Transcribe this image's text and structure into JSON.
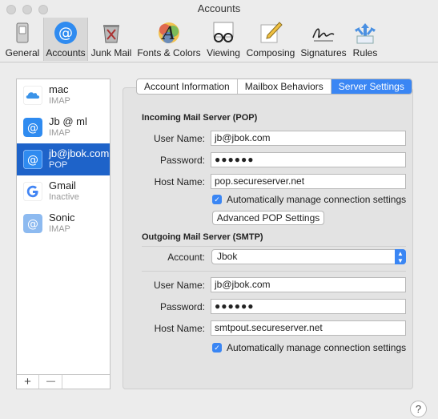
{
  "window": {
    "title": "Accounts"
  },
  "toolbar": {
    "items": [
      {
        "label": "General",
        "icon": "switch-icon"
      },
      {
        "label": "Accounts",
        "icon": "at-sign-icon"
      },
      {
        "label": "Junk Mail",
        "icon": "trash-bin-icon"
      },
      {
        "label": "Fonts & Colors",
        "icon": "font-a-icon"
      },
      {
        "label": "Viewing",
        "icon": "glasses-icon"
      },
      {
        "label": "Composing",
        "icon": "pencil-icon"
      },
      {
        "label": "Signatures",
        "icon": "signature-icon"
      },
      {
        "label": "Rules",
        "icon": "rules-arrows-icon"
      }
    ]
  },
  "accounts": [
    {
      "name": "mac",
      "type": "IMAP",
      "icon": "icloud-icon"
    },
    {
      "name": "Jb @ ml",
      "type": "IMAP",
      "icon": "at-sign-icon"
    },
    {
      "name": "jb@jbok.com",
      "type": "POP",
      "icon": "at-sign-icon"
    },
    {
      "name": "Gmail",
      "type": "Inactive",
      "icon": "google-g-icon"
    },
    {
      "name": "Sonic",
      "type": "IMAP",
      "icon": "at-sign-icon"
    }
  ],
  "account_footer": {
    "add": "+",
    "remove": "—"
  },
  "tabs": [
    "Account Information",
    "Mailbox Behaviors",
    "Server Settings"
  ],
  "incoming": {
    "heading": "Incoming Mail Server (POP)",
    "user_label": "User Name:",
    "user_value": "jb@jbok.com",
    "password_label": "Password:",
    "password_value": "●●●●●●",
    "host_label": "Host Name:",
    "host_value": "pop.secureserver.net",
    "auto_manage": "Automatically manage connection settings",
    "advanced_button": "Advanced POP Settings"
  },
  "outgoing": {
    "heading": "Outgoing Mail Server (SMTP)",
    "account_label": "Account:",
    "account_value": "Jbok",
    "user_label": "User Name:",
    "user_value": "jb@jbok.com",
    "password_label": "Password:",
    "password_value": "●●●●●●",
    "host_label": "Host Name:",
    "host_value": "smtpout.secureserver.net",
    "auto_manage": "Automatically manage connection settings"
  },
  "help": "?",
  "colors": {
    "accent": "#3a86f4",
    "selection": "#1e63c9"
  }
}
